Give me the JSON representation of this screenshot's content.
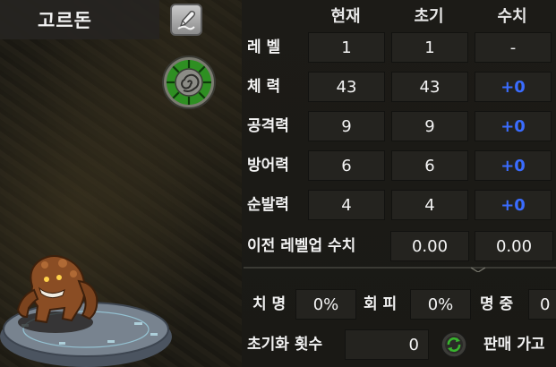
{
  "character": {
    "name": "고르돈"
  },
  "icons": {
    "edit": "edit-pencil-icon",
    "emblem": "spiral-shell-emblem-icon",
    "reset": "refresh-green-icon"
  },
  "stats_table": {
    "headers": {
      "current": "현재",
      "initial": "초기",
      "value": "수치"
    },
    "rows": [
      {
        "label": "레 벨",
        "current": "1",
        "initial": "1",
        "value": "-",
        "value_color": "#ffffff"
      },
      {
        "label": "체 력",
        "current": "43",
        "initial": "43",
        "value": "+0",
        "value_color": "#3a6cff"
      },
      {
        "label": "공격력",
        "current": "9",
        "initial": "9",
        "value": "+0",
        "value_color": "#3a6cff"
      },
      {
        "label": "방어력",
        "current": "6",
        "initial": "6",
        "value": "+0",
        "value_color": "#3a6cff"
      },
      {
        "label": "순발력",
        "current": "4",
        "initial": "4",
        "value": "+0",
        "value_color": "#3a6cff"
      }
    ],
    "prev_levelup": {
      "label": "이전 레벨업 수치",
      "value1": "0.00",
      "value2": "0.00"
    }
  },
  "combat_stats": {
    "crit_label": "치 명",
    "crit_value": "0%",
    "evade_label": "회 피",
    "evade_value": "0%",
    "accuracy_label": "명 중",
    "accuracy_value": "0"
  },
  "reset": {
    "label": "초기화 횟수",
    "value": "0"
  },
  "sell": {
    "label": "판매 가고"
  },
  "colors": {
    "accent_blue": "#3a6cff",
    "reset_green": "#38b52e"
  }
}
